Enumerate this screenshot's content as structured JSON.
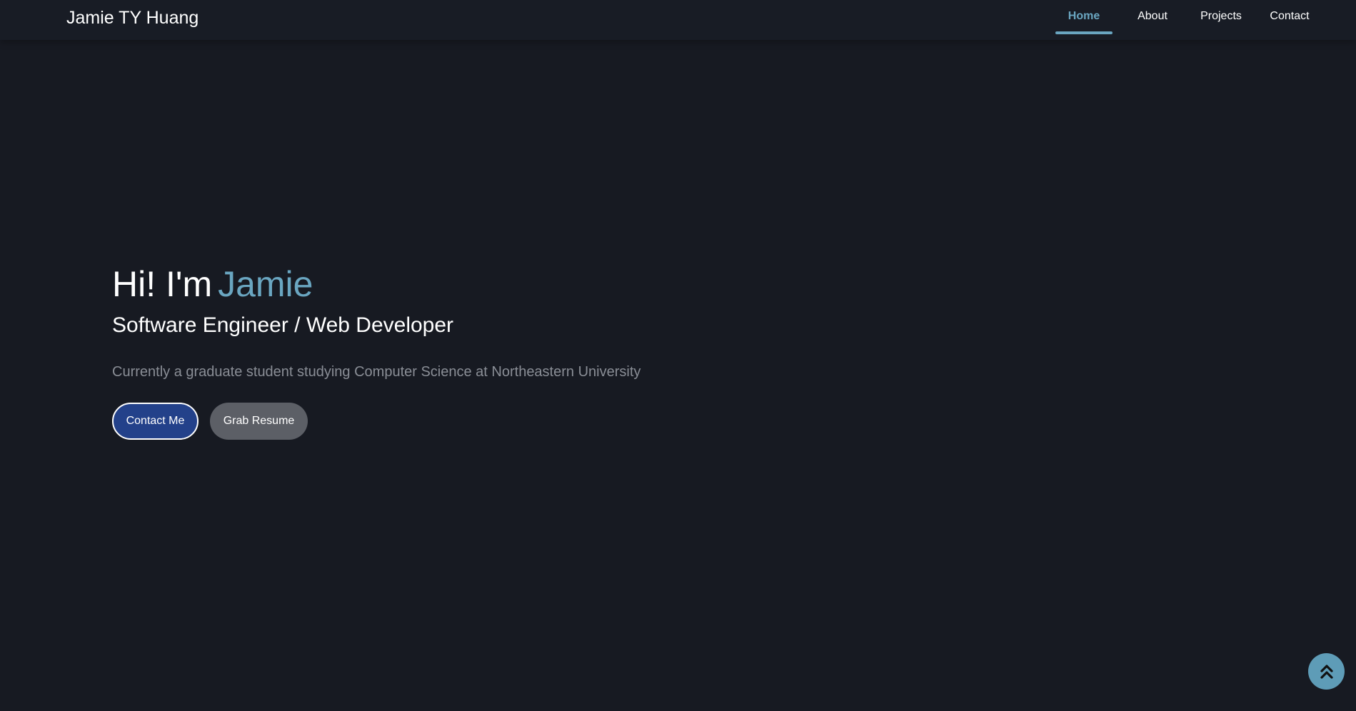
{
  "navbar": {
    "brand": "Jamie TY Huang",
    "links": [
      {
        "label": "Home",
        "active": true
      },
      {
        "label": "About",
        "active": false
      },
      {
        "label": "Projects",
        "active": false
      },
      {
        "label": "Contact",
        "active": false
      }
    ]
  },
  "hero": {
    "greeting_prefix": "Hi! I'm",
    "greeting_name": "Jamie",
    "subtitle": "Software Engineer / Web Developer",
    "description": "Currently a graduate student studying Computer Science at Northeastern University",
    "buttons": {
      "contact": "Contact Me",
      "resume": "Grab Resume"
    }
  },
  "scroll_top": {
    "icon": "double-chevron-up-icon"
  },
  "colors": {
    "background": "#171a22",
    "accent": "#6aa6c1",
    "primary_button": "#23418a",
    "secondary_button": "#5c5f66",
    "muted_text": "#8a8e96"
  }
}
